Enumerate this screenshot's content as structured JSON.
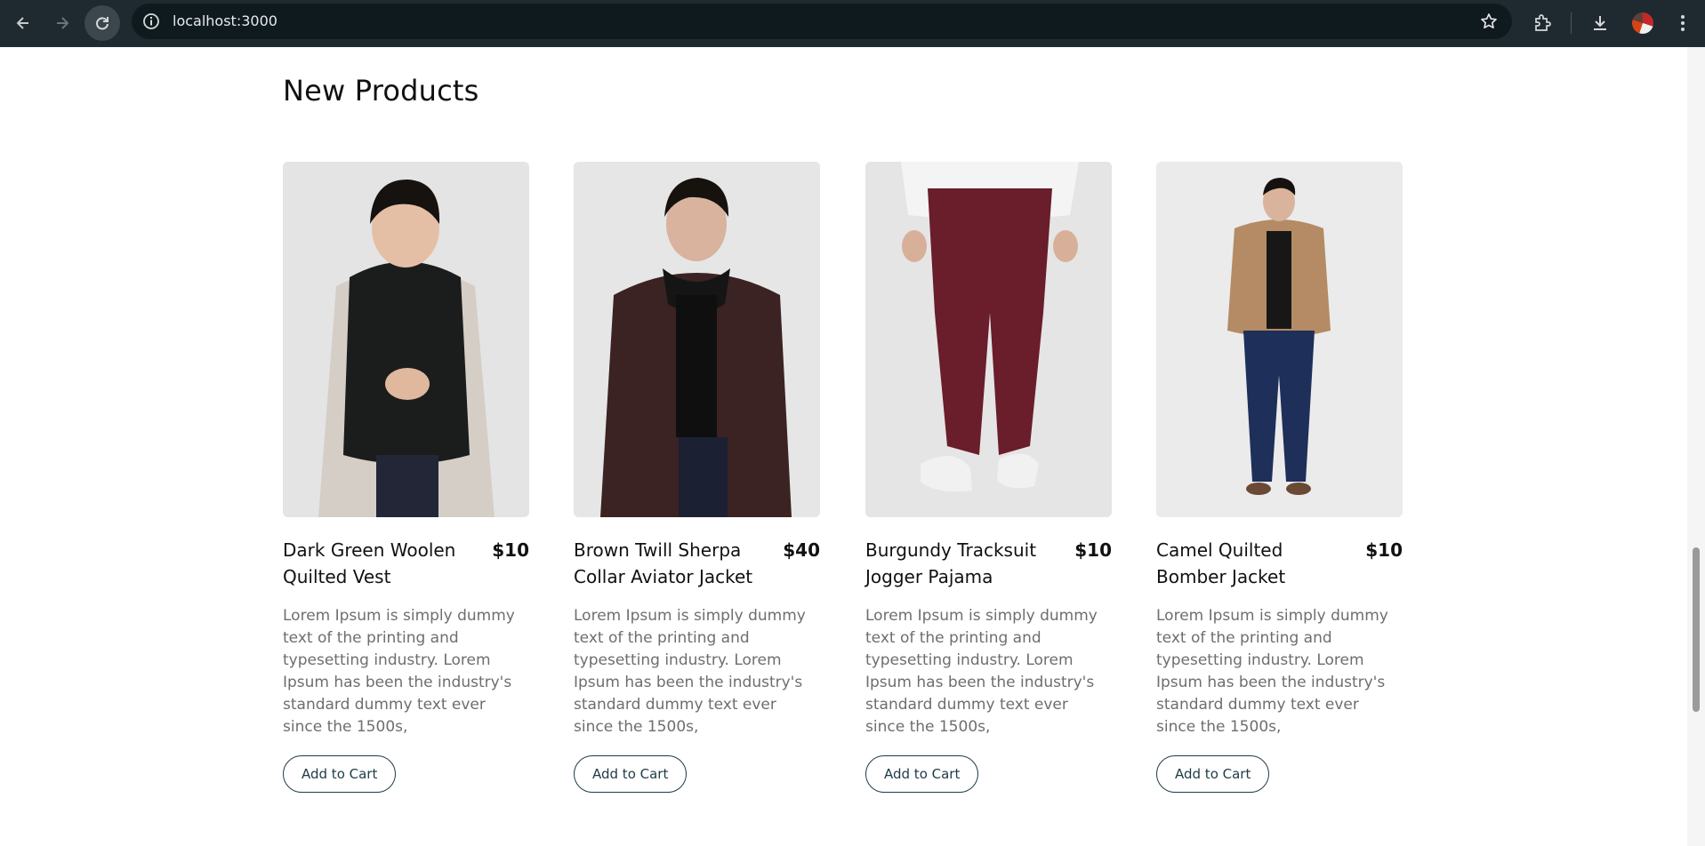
{
  "browser": {
    "url": "localhost:3000",
    "icons": [
      "back-arrow-icon",
      "forward-arrow-icon",
      "reload-icon",
      "site-info-icon",
      "bookmark-star-icon",
      "extensions-icon",
      "download-icon",
      "profile-avatar",
      "more-menu-icon"
    ]
  },
  "section": {
    "title": "New Products"
  },
  "products": [
    {
      "name": "Dark Green Woolen Quilted Vest",
      "price": "$10",
      "description": "Lorem Ipsum is simply dummy text of the printing and typesetting industry. Lorem Ipsum has been the industry's standard dummy text ever since the 1500s,",
      "button": "Add to Cart"
    },
    {
      "name": "Brown Twill Sherpa Collar Aviator Jacket",
      "price": "$40",
      "description": "Lorem Ipsum is simply dummy text of the printing and typesetting industry. Lorem Ipsum has been the industry's standard dummy text ever since the 1500s,",
      "button": "Add to Cart"
    },
    {
      "name": "Burgundy Tracksuit Jogger Pajama",
      "price": "$10",
      "description": "Lorem Ipsum is simply dummy text of the printing and typesetting industry. Lorem Ipsum has been the industry's standard dummy text ever since the 1500s,",
      "button": "Add to Cart"
    },
    {
      "name": "Camel Quilted Bomber Jacket",
      "price": "$10",
      "description": "Lorem Ipsum is simply dummy text of the printing and typesetting industry. Lorem Ipsum has been the industry's standard dummy text ever since the 1500s,",
      "button": "Add to Cart"
    }
  ]
}
